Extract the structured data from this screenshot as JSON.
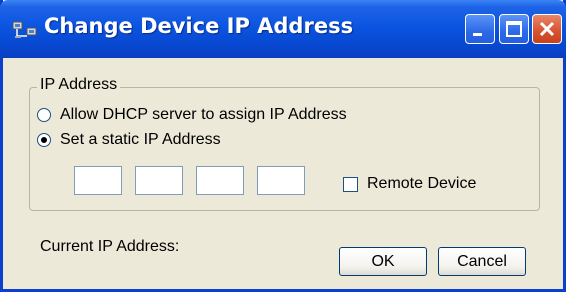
{
  "window": {
    "title": "Change Device IP Address",
    "icon": "network-computers-icon",
    "controls": [
      "minimize-icon",
      "maximize-icon",
      "close-icon"
    ]
  },
  "ip_group": {
    "label": "IP Address",
    "options": [
      {
        "label": "Allow DHCP server to assign IP Address",
        "selected": false
      },
      {
        "label": "Set a static IP Address",
        "selected": true
      }
    ],
    "octets": [
      "",
      "",
      "",
      ""
    ],
    "remote_device": {
      "label": "Remote Device",
      "checked": false
    }
  },
  "current_ip": {
    "label": "Current IP Address:"
  },
  "buttons": {
    "ok": "OK",
    "cancel": "Cancel"
  }
}
